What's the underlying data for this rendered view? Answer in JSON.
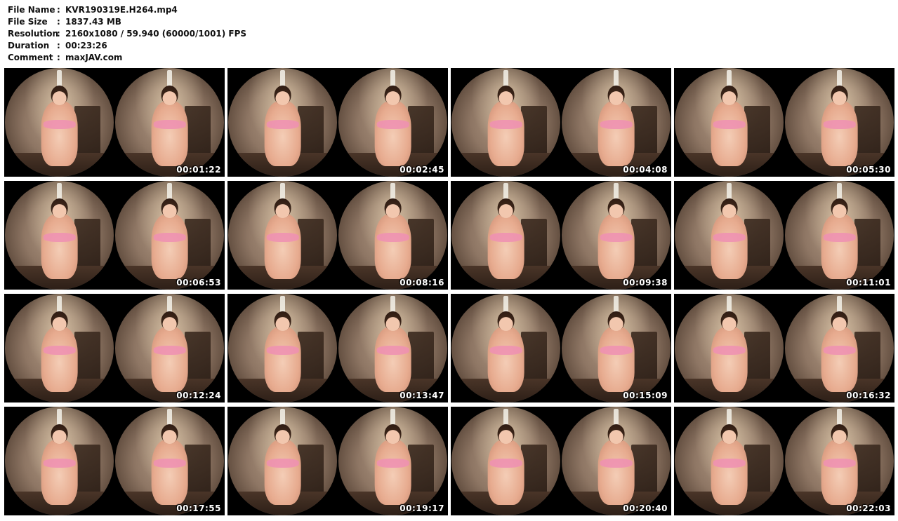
{
  "info": [
    {
      "label": "File Name",
      "sep": ":",
      "value": "KVR190319E.H264.mp4"
    },
    {
      "label": "File Size",
      "sep": ":",
      "value": "1837.43 MB"
    },
    {
      "label": "Resolution",
      "sep": ":",
      "value": "2160x1080 / 59.940 (60000/1001) FPS"
    },
    {
      "label": "Duration",
      "sep": ":",
      "value": "00:23:26"
    },
    {
      "label": "Comment",
      "sep": ":",
      "value": "maxJAV.com"
    }
  ],
  "thumbnails": [
    {
      "time": "00:01:22"
    },
    {
      "time": "00:02:45"
    },
    {
      "time": "00:04:08"
    },
    {
      "time": "00:05:30"
    },
    {
      "time": "00:06:53"
    },
    {
      "time": "00:08:16"
    },
    {
      "time": "00:09:38"
    },
    {
      "time": "00:11:01"
    },
    {
      "time": "00:12:24"
    },
    {
      "time": "00:13:47"
    },
    {
      "time": "00:15:09"
    },
    {
      "time": "00:16:32"
    },
    {
      "time": "00:17:55"
    },
    {
      "time": "00:19:17"
    },
    {
      "time": "00:20:40"
    },
    {
      "time": "00:22:03"
    }
  ]
}
